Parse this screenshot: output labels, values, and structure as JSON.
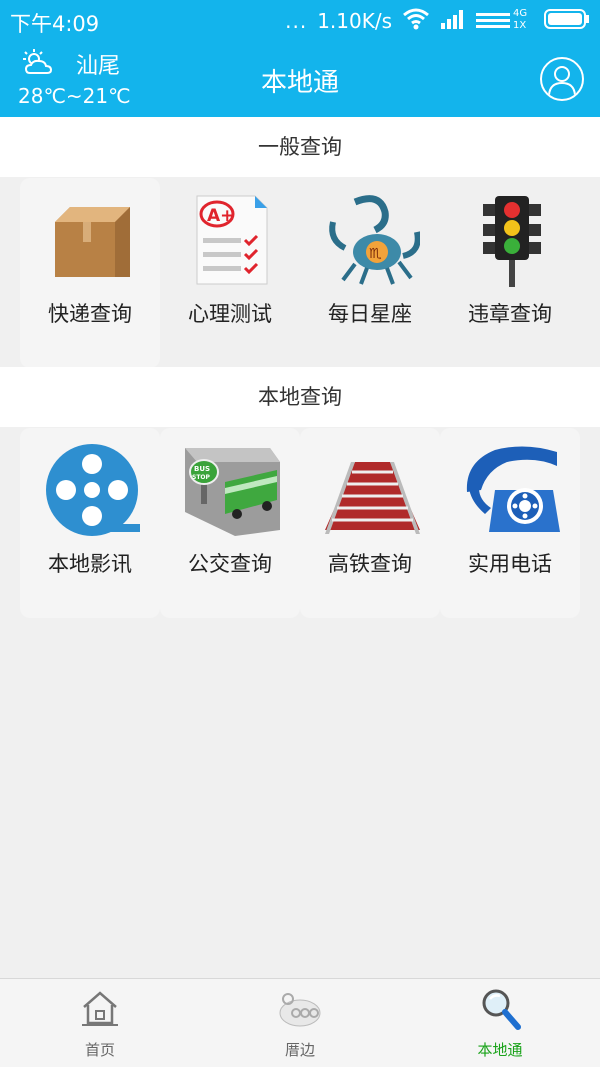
{
  "status_bar": {
    "time": "下午4:09",
    "dots": "...",
    "speed": "1.10K/s",
    "network_label_top": "4G",
    "network_label_bottom": "1X"
  },
  "header": {
    "city": "汕尾",
    "temperature": "28℃~21℃",
    "title": "本地通"
  },
  "sections": [
    {
      "title": "一般查询",
      "items": [
        {
          "label": "快递查询",
          "icon": "package-icon"
        },
        {
          "label": "心理测试",
          "icon": "test-paper-icon"
        },
        {
          "label": "每日星座",
          "icon": "scorpio-icon"
        },
        {
          "label": "违章查询",
          "icon": "traffic-light-icon"
        }
      ]
    },
    {
      "title": "本地查询",
      "items": [
        {
          "label": "本地影讯",
          "icon": "film-reel-icon"
        },
        {
          "label": "公交查询",
          "icon": "bus-stop-icon"
        },
        {
          "label": "高铁查询",
          "icon": "stairs-icon"
        },
        {
          "label": "实用电话",
          "icon": "telephone-icon"
        }
      ]
    }
  ],
  "tabs": [
    {
      "label": "首页",
      "icon": "home-icon",
      "active": false
    },
    {
      "label": "厝边",
      "icon": "neighbors-icon",
      "active": false
    },
    {
      "label": "本地通",
      "icon": "magnifier-icon",
      "active": true
    }
  ],
  "colors": {
    "header_bg": "#13b4ec",
    "active_tab": "#1aa31a"
  }
}
